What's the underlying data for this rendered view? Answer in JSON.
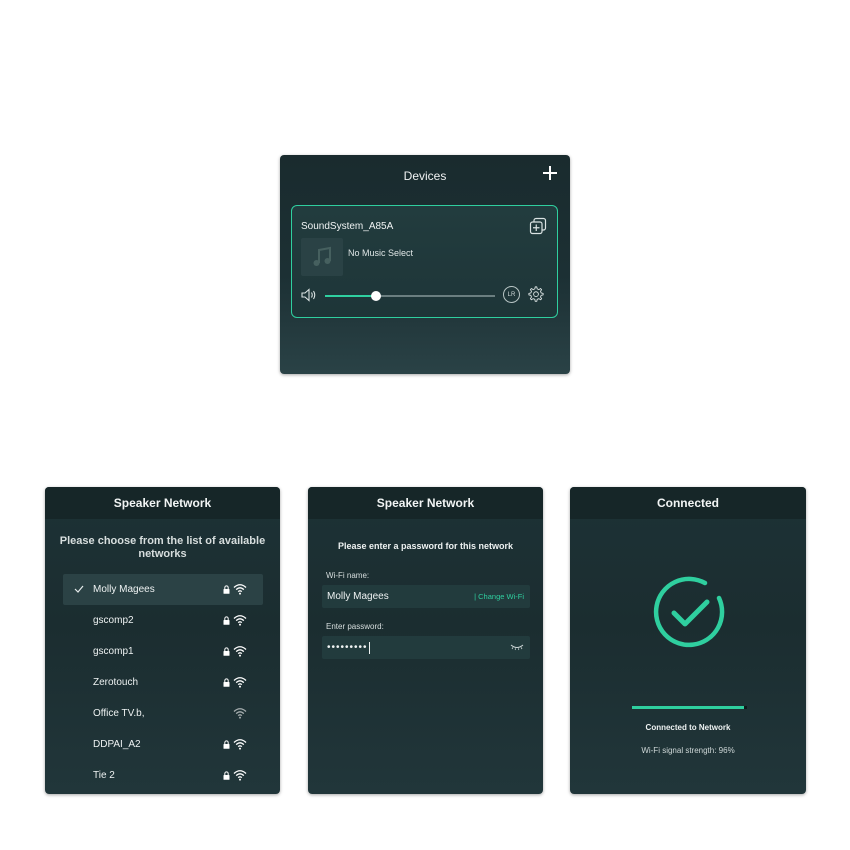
{
  "devices_panel": {
    "title": "Devices",
    "add_icon": "plus-icon",
    "device": {
      "name": "SoundSystem_A85A",
      "track": "No Music Select",
      "volume": 0.3,
      "channel_label": "LR",
      "icons": [
        "group-icon",
        "music-note-icon",
        "volume-icon",
        "gear-icon"
      ]
    }
  },
  "network_list_panel": {
    "title": "Speaker Network",
    "instructions": "Please choose from the list of available networks",
    "networks": [
      {
        "name": "Molly Magees",
        "selected": true,
        "locked": true
      },
      {
        "name": "gscomp2",
        "selected": false,
        "locked": true
      },
      {
        "name": "gscomp1",
        "selected": false,
        "locked": true
      },
      {
        "name": "Zerotouch",
        "selected": false,
        "locked": true
      },
      {
        "name": "Office TV.b,",
        "selected": false,
        "locked": false
      },
      {
        "name": "DDPAI_A2",
        "selected": false,
        "locked": true
      },
      {
        "name": "Tie 2",
        "selected": false,
        "locked": true
      }
    ]
  },
  "password_panel": {
    "title": "Speaker Network",
    "prompt": "Please enter a password for this network",
    "wifi_label": "Wi-Fi name:",
    "wifi_value": "Molly Magees",
    "change_link": "| Change Wi-Fi",
    "password_label": "Enter password:",
    "password_value": "•••••••••"
  },
  "connected_panel": {
    "title": "Connected",
    "progress": 0.97,
    "status": "Connected to Network",
    "signal": "Wi-Fi signal strength: 96%"
  },
  "colors": {
    "accent": "#2fcf9f",
    "panel_bg": "#1d3236",
    "header_bg": "#162628"
  }
}
